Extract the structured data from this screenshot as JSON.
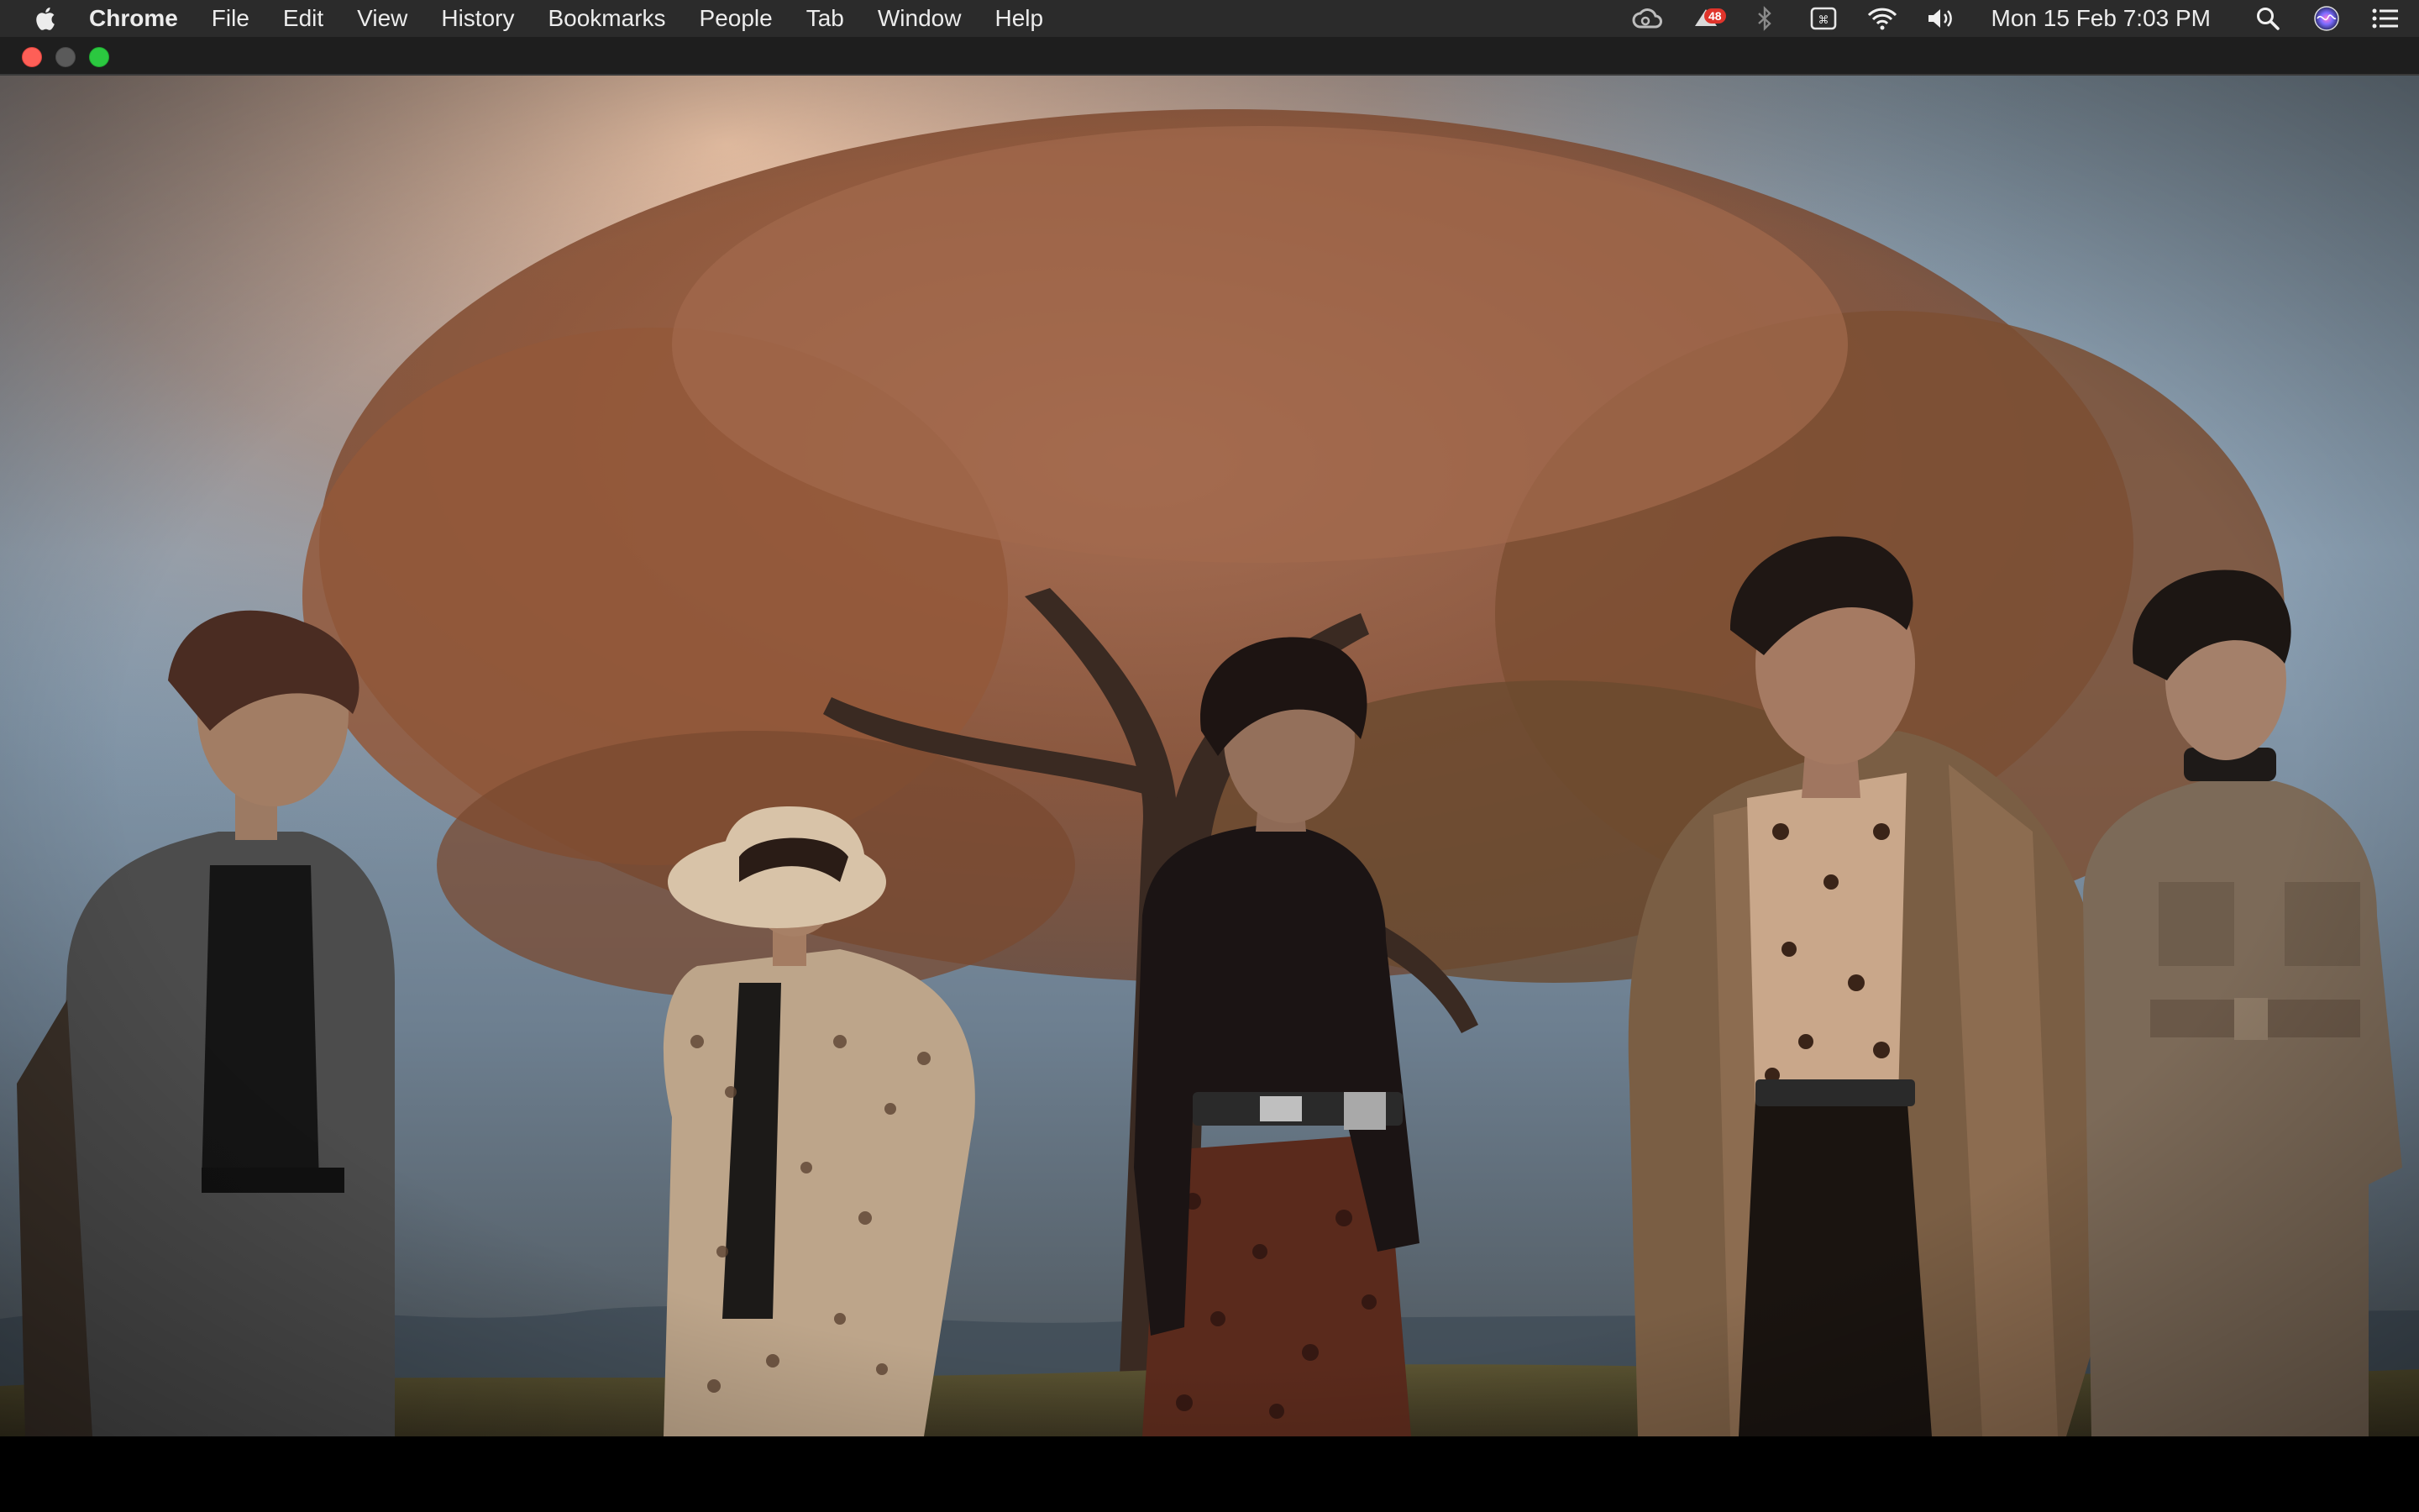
{
  "menubar": {
    "app_name": "Chrome",
    "items": [
      "File",
      "Edit",
      "View",
      "History",
      "Bookmarks",
      "People",
      "Tab",
      "Window",
      "Help"
    ],
    "clock": "Mon 15 Feb  7:03 PM",
    "badge_count": "48",
    "status_icons": [
      "creative-cloud-icon",
      "notification-app-icon",
      "bluetooth-icon",
      "keyboard-icon",
      "wifi-icon",
      "volume-icon",
      "search-icon",
      "siri-icon",
      "control-center-icon"
    ]
  },
  "window": {
    "traffic_lights": [
      "close",
      "minimize",
      "maximize"
    ]
  },
  "video": {
    "scene": "five-people-standing-under-tree"
  }
}
